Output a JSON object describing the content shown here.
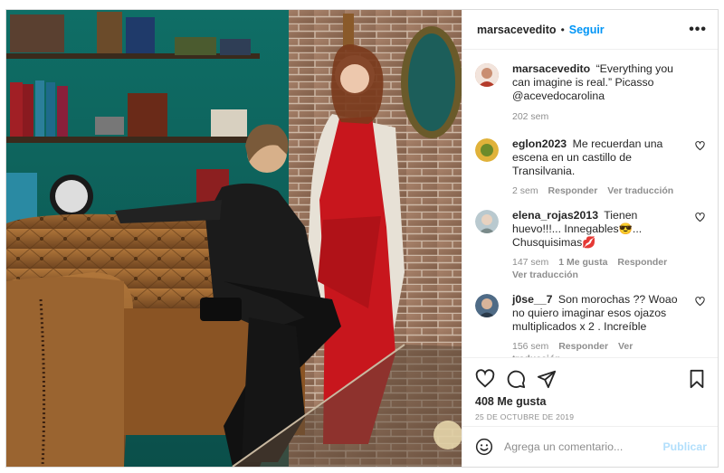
{
  "header": {
    "username": "marsacevedito",
    "separator": "•",
    "follow_label": "Seguir",
    "more_label": "•••"
  },
  "caption": {
    "username": "marsacevedito",
    "text": "“Everything you can imagine is real.” Picasso @acevedocarolina",
    "time": "202 sem"
  },
  "comments": [
    {
      "username": "eglon2023",
      "text": "Me recuerdan una escena en un castillo de Transilvania.",
      "time": "2 sem",
      "likes": "",
      "reply_label": "Responder",
      "translate_label": "Ver traducción",
      "avatar_color": "#e0b23a"
    },
    {
      "username": "elena_rojas2013",
      "text": "Tienen huevo!!!... Innegables😎... Chusquisimas💋",
      "time": "147 sem",
      "likes": "1 Me gusta",
      "reply_label": "Responder",
      "translate_label": "Ver traducción",
      "avatar_color": "#b9c9cf"
    },
    {
      "username": "j0se__7",
      "text": "Son morochas ?? Woao no quiero imaginar esos ojazos multiplicados x 2 . Increíble",
      "time": "156 sem",
      "likes": "",
      "reply_label": "Responder",
      "translate_label": "Ver traducción",
      "avatar_color": "#4f6b86"
    }
  ],
  "actions": {
    "likes_text": "408 Me gusta",
    "date_text": "25 de octubre de 2019",
    "icons": [
      "heart-icon",
      "comment-icon",
      "share-icon",
      "bookmark-icon"
    ]
  },
  "composer": {
    "placeholder": "Agrega un comentario...",
    "publish_label": "Publicar",
    "icon": "emoji-icon"
  },
  "colors": {
    "link_blue": "#0095f6",
    "publish_disabled": "#b2dffc",
    "secondary_text": "#8e8e8e"
  }
}
